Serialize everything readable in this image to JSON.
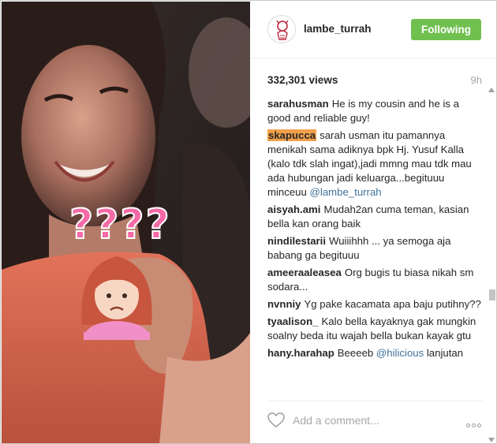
{
  "post": {
    "username": "lambe_turrah",
    "follow_label": "Following",
    "views": "332,301 views",
    "time": "9h"
  },
  "comments": [
    {
      "user": "sarahusman",
      "highlight": false,
      "text": "He is my cousin and he is a good and reliable guy!",
      "mention": ""
    },
    {
      "user": "skapucca",
      "highlight": true,
      "text": "sarah usman itu pamannya menikah sama adiknya bpk Hj. Yusuf Kalla (kalo tdk slah ingat),jadi mmng mau tdk mau ada hubungan jadi keluarga...begituuu minceuu",
      "mention": "@lambe_turrah"
    },
    {
      "user": "aisyah.ami",
      "highlight": false,
      "text": "Mudah2an cuma teman, kasian bella kan orang baik",
      "mention": ""
    },
    {
      "user": "nindilestarii",
      "highlight": false,
      "text": "Wuiiihhh ... ya semoga aja babang ga begituuu",
      "mention": ""
    },
    {
      "user": "ameeraaleasea",
      "highlight": false,
      "text": "Org bugis tu biasa nikah sm sodara...",
      "mention": ""
    },
    {
      "user": "nvnniy",
      "highlight": false,
      "text": "Yg pake kacamata apa baju putihny??",
      "mention": ""
    },
    {
      "user": "tyaalison_",
      "highlight": false,
      "text": "Kalo bella kayaknya gak mungkin soalny beda itu wajah bella bukan kayak gtu",
      "mention": ""
    },
    {
      "user": "hany.harahap",
      "highlight": false,
      "text": "Beeeeb",
      "mention": "@hilicious",
      "after": "lanjutan"
    }
  ],
  "footer": {
    "comment_placeholder": "Add a comment...",
    "like_icon": "heart-outline-icon",
    "more_icon": "more-options-icon"
  },
  "media": {
    "overlay_text": "????",
    "emoji": "person-frowning-emoji"
  },
  "colors": {
    "follow_green": "#70c050",
    "highlight_orange": "#f0a04b",
    "mention_blue": "#3f729b",
    "overlay_pink": "#f56aa6"
  }
}
